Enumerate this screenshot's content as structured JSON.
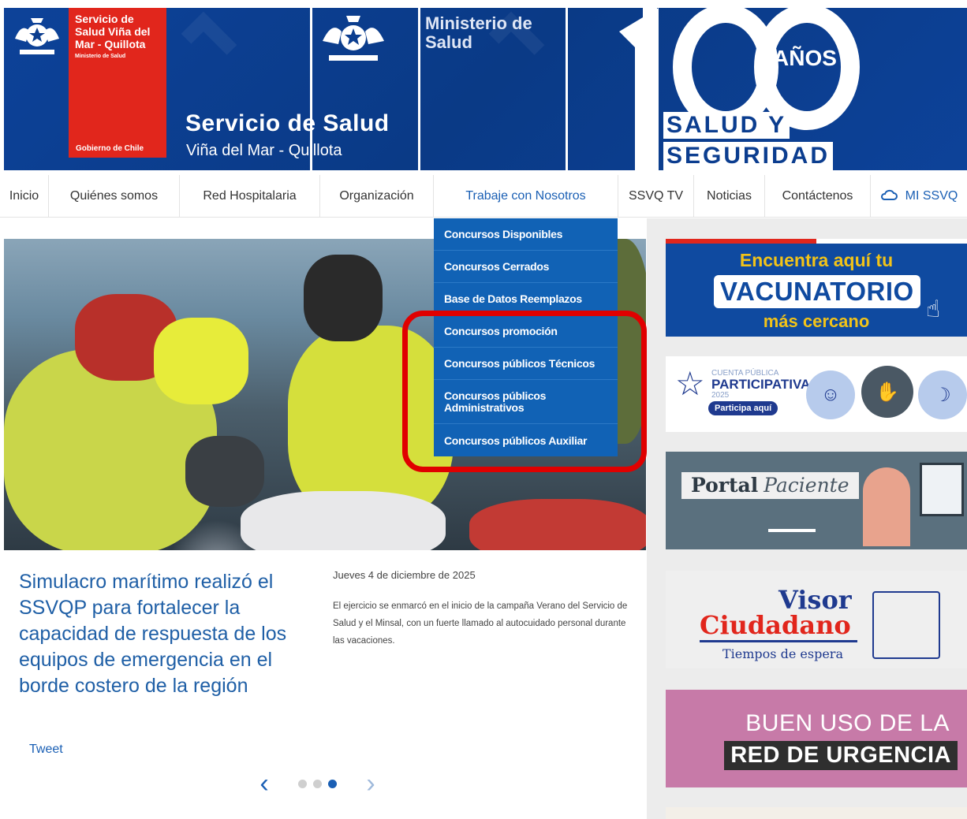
{
  "header": {
    "red_block_title": "Servicio de Salud Viña del Mar - Quillota",
    "red_block_subtitle": "Ministerio de Salud",
    "red_block_footer": "Gobierno de Chile",
    "site_title": "Servicio de Salud",
    "site_subtitle": "Viña del Mar - Quillota",
    "ministry": "Ministerio de Salud",
    "centenary_number": "100",
    "centenary_years": "AÑOS",
    "centenary_line1": "SALUD Y",
    "centenary_line2": "SEGURIDAD"
  },
  "nav": {
    "items": [
      {
        "label": "Inicio"
      },
      {
        "label": "Quiénes somos"
      },
      {
        "label": "Red Hospitalaria"
      },
      {
        "label": "Organización"
      },
      {
        "label": "Trabaje con Nosotros"
      },
      {
        "label": "SSVQ TV"
      },
      {
        "label": "Noticias"
      },
      {
        "label": "Contáctenos"
      },
      {
        "label": "MI SSVQ",
        "icon": "cloud-icon"
      }
    ],
    "active": "Trabaje con Nosotros"
  },
  "dropdown": {
    "items": [
      "Concursos Disponibles",
      "Concursos Cerrados",
      "Base de Datos Reemplazos",
      "Concursos promoción",
      "Concursos públicos Técnicos",
      "Concursos públicos Administrativos",
      "Concursos públicos Auxiliar"
    ],
    "highlight_color": "#e00000"
  },
  "article": {
    "title": "Simulacro marítimo realizó el SSVQP para fortalecer la capacidad de respuesta de los equipos de emergencia en el borde costero de la región",
    "date": "Jueves 4 de diciembre de 2025",
    "summary": "El ejercicio se enmarcó en el inicio de la campaña Verano del Servicio de Salud y el Minsal, con un fuerte llamado al autocuidado personal durante las vacaciones.",
    "tweet": "Tweet"
  },
  "carousel": {
    "prev_icon": "chevron-left-icon",
    "next_icon": "chevron-right-icon",
    "slides": 3,
    "active_slide": 3
  },
  "sidebar": {
    "vacunatorio": {
      "line1": "Encuentra aquí tu",
      "line2": "VACUNATORIO",
      "line3": "más cercano"
    },
    "cuenta_publica": {
      "line1": "CUENTA PÚBLICA",
      "line2": "PARTICIPATIVA",
      "line3": "2025",
      "button": "Participa aquí"
    },
    "portal": {
      "bold": "Portal",
      "italic": "Paciente"
    },
    "visor": {
      "line1": "Visor",
      "line2": "Ciudadano",
      "line3": "Tiempos de espera"
    },
    "urgencia": {
      "line1": "BUEN USO DE LA",
      "line2": "RED DE URGENCIA"
    }
  },
  "colors": {
    "brand_blue": "#0b3d8f",
    "gov_red": "#e1261c",
    "link_blue": "#1a5fb4",
    "dropdown_blue": "#1162b5"
  }
}
